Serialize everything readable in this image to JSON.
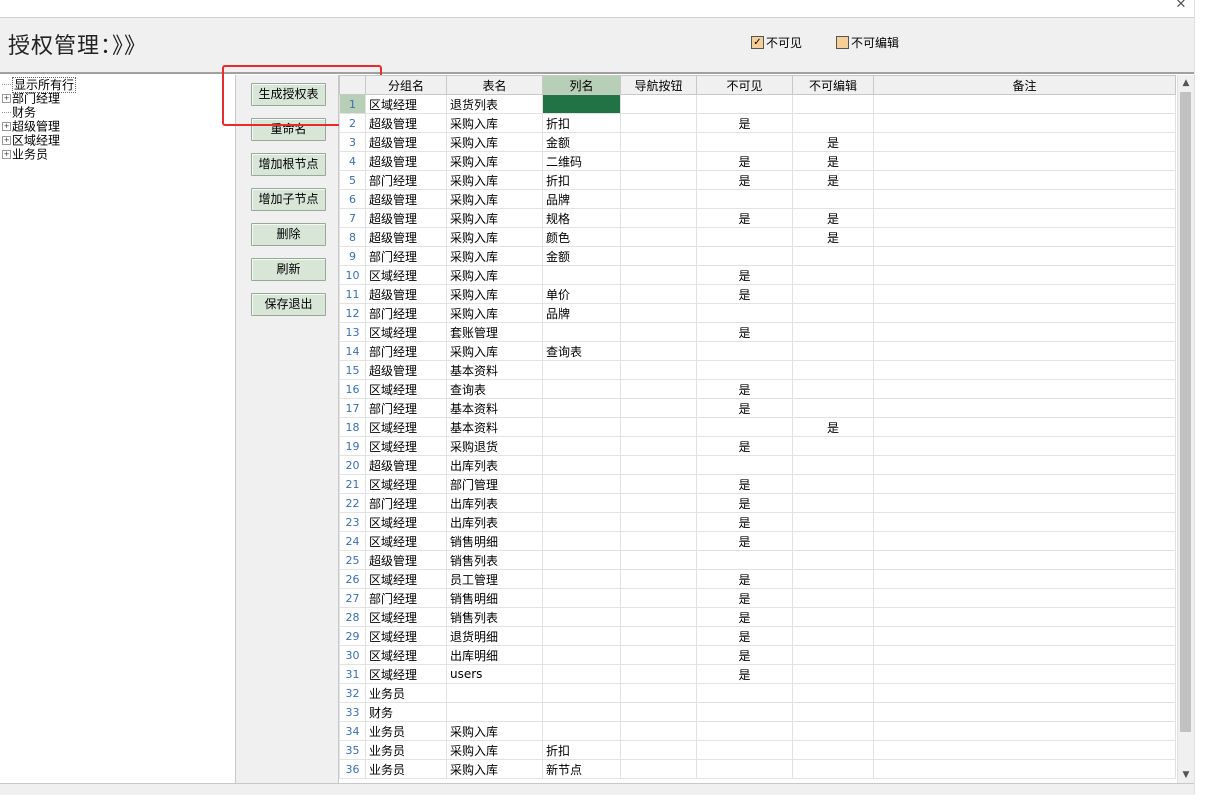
{
  "window": {
    "close_glyph": "✕"
  },
  "header": {
    "title": "授权管理：》》",
    "checkboxes": [
      {
        "label": "不可见",
        "checked": true
      },
      {
        "label": "不可编辑",
        "checked": false
      }
    ]
  },
  "tree": {
    "items": [
      {
        "label": "显示所有行",
        "expander": "",
        "selected": true
      },
      {
        "label": "部门经理",
        "expander": "+",
        "selected": false
      },
      {
        "label": "财务",
        "expander": "",
        "selected": false
      },
      {
        "label": "超级管理",
        "expander": "+",
        "selected": false
      },
      {
        "label": "区域经理",
        "expander": "+",
        "selected": false
      },
      {
        "label": "业务员",
        "expander": "+",
        "selected": false
      }
    ]
  },
  "buttons": {
    "generate": "生成授权表",
    "rename": "重命名",
    "add_root": "增加根节点",
    "add_child": "增加子节点",
    "delete": "删除",
    "refresh": "刷新",
    "save_exit": "保存退出"
  },
  "grid": {
    "columns": [
      "",
      "分组名",
      "表名",
      "列名",
      "导航按钮",
      "不可见",
      "不可编辑",
      "备注"
    ],
    "active_column": "列名",
    "current_row": 1,
    "rows": [
      {
        "n": "1",
        "group": "区域经理",
        "table": "退货列表",
        "col": "",
        "nav": "",
        "invisible": "",
        "noedit": "",
        "note": ""
      },
      {
        "n": "2",
        "group": "超级管理",
        "table": "采购入库",
        "col": "折扣",
        "nav": "",
        "invisible": "是",
        "noedit": "",
        "note": ""
      },
      {
        "n": "3",
        "group": "超级管理",
        "table": "采购入库",
        "col": "金额",
        "nav": "",
        "invisible": "",
        "noedit": "是",
        "note": ""
      },
      {
        "n": "4",
        "group": "超级管理",
        "table": "采购入库",
        "col": "二维码",
        "nav": "",
        "invisible": "是",
        "noedit": "是",
        "note": ""
      },
      {
        "n": "5",
        "group": "部门经理",
        "table": "采购入库",
        "col": "折扣",
        "nav": "",
        "invisible": "是",
        "noedit": "是",
        "note": ""
      },
      {
        "n": "6",
        "group": "超级管理",
        "table": "采购入库",
        "col": "品牌",
        "nav": "",
        "invisible": "",
        "noedit": "",
        "note": ""
      },
      {
        "n": "7",
        "group": "超级管理",
        "table": "采购入库",
        "col": "规格",
        "nav": "",
        "invisible": "是",
        "noedit": "是",
        "note": ""
      },
      {
        "n": "8",
        "group": "超级管理",
        "table": "采购入库",
        "col": "颜色",
        "nav": "",
        "invisible": "",
        "noedit": "是",
        "note": ""
      },
      {
        "n": "9",
        "group": "部门经理",
        "table": "采购入库",
        "col": "金额",
        "nav": "",
        "invisible": "",
        "noedit": "",
        "note": ""
      },
      {
        "n": "10",
        "group": "区域经理",
        "table": "采购入库",
        "col": "",
        "nav": "",
        "invisible": "是",
        "noedit": "",
        "note": ""
      },
      {
        "n": "11",
        "group": "超级管理",
        "table": "采购入库",
        "col": "单价",
        "nav": "",
        "invisible": "是",
        "noedit": "",
        "note": ""
      },
      {
        "n": "12",
        "group": "部门经理",
        "table": "采购入库",
        "col": "品牌",
        "nav": "",
        "invisible": "",
        "noedit": "",
        "note": ""
      },
      {
        "n": "13",
        "group": "区域经理",
        "table": "套账管理",
        "col": "",
        "nav": "",
        "invisible": "是",
        "noedit": "",
        "note": ""
      },
      {
        "n": "14",
        "group": "部门经理",
        "table": "采购入库",
        "col": "查询表",
        "nav": "",
        "invisible": "",
        "noedit": "",
        "note": ""
      },
      {
        "n": "15",
        "group": "超级管理",
        "table": "基本资料",
        "col": "",
        "nav": "",
        "invisible": "",
        "noedit": "",
        "note": ""
      },
      {
        "n": "16",
        "group": "区域经理",
        "table": "查询表",
        "col": "",
        "nav": "",
        "invisible": "是",
        "noedit": "",
        "note": ""
      },
      {
        "n": "17",
        "group": "部门经理",
        "table": "基本资料",
        "col": "",
        "nav": "",
        "invisible": "是",
        "noedit": "",
        "note": ""
      },
      {
        "n": "18",
        "group": "区域经理",
        "table": "基本资料",
        "col": "",
        "nav": "",
        "invisible": "",
        "noedit": "是",
        "note": ""
      },
      {
        "n": "19",
        "group": "区域经理",
        "table": "采购退货",
        "col": "",
        "nav": "",
        "invisible": "是",
        "noedit": "",
        "note": ""
      },
      {
        "n": "20",
        "group": "超级管理",
        "table": "出库列表",
        "col": "",
        "nav": "",
        "invisible": "",
        "noedit": "",
        "note": ""
      },
      {
        "n": "21",
        "group": "区域经理",
        "table": "部门管理",
        "col": "",
        "nav": "",
        "invisible": "是",
        "noedit": "",
        "note": ""
      },
      {
        "n": "22",
        "group": "部门经理",
        "table": "出库列表",
        "col": "",
        "nav": "",
        "invisible": "是",
        "noedit": "",
        "note": ""
      },
      {
        "n": "23",
        "group": "区域经理",
        "table": "出库列表",
        "col": "",
        "nav": "",
        "invisible": "是",
        "noedit": "",
        "note": ""
      },
      {
        "n": "24",
        "group": "区域经理",
        "table": "销售明细",
        "col": "",
        "nav": "",
        "invisible": "是",
        "noedit": "",
        "note": ""
      },
      {
        "n": "25",
        "group": "超级管理",
        "table": "销售列表",
        "col": "",
        "nav": "",
        "invisible": "",
        "noedit": "",
        "note": ""
      },
      {
        "n": "26",
        "group": "区域经理",
        "table": "员工管理",
        "col": "",
        "nav": "",
        "invisible": "是",
        "noedit": "",
        "note": ""
      },
      {
        "n": "27",
        "group": "部门经理",
        "table": "销售明细",
        "col": "",
        "nav": "",
        "invisible": "是",
        "noedit": "",
        "note": ""
      },
      {
        "n": "28",
        "group": "区域经理",
        "table": "销售列表",
        "col": "",
        "nav": "",
        "invisible": "是",
        "noedit": "",
        "note": ""
      },
      {
        "n": "29",
        "group": "区域经理",
        "table": "退货明细",
        "col": "",
        "nav": "",
        "invisible": "是",
        "noedit": "",
        "note": ""
      },
      {
        "n": "30",
        "group": "区域经理",
        "table": "出库明细",
        "col": "",
        "nav": "",
        "invisible": "是",
        "noedit": "",
        "note": ""
      },
      {
        "n": "31",
        "group": "区域经理",
        "table": "users",
        "col": "",
        "nav": "",
        "invisible": "是",
        "noedit": "",
        "note": ""
      },
      {
        "n": "32",
        "group": "业务员",
        "table": "",
        "col": "",
        "nav": "",
        "invisible": "",
        "noedit": "",
        "note": ""
      },
      {
        "n": "33",
        "group": "财务",
        "table": "",
        "col": "",
        "nav": "",
        "invisible": "",
        "noedit": "",
        "note": ""
      },
      {
        "n": "34",
        "group": "业务员",
        "table": "采购入库",
        "col": "",
        "nav": "",
        "invisible": "",
        "noedit": "",
        "note": ""
      },
      {
        "n": "35",
        "group": "业务员",
        "table": "采购入库",
        "col": "折扣",
        "nav": "",
        "invisible": "",
        "noedit": "",
        "note": ""
      },
      {
        "n": "36",
        "group": "业务员",
        "table": "采购入库",
        "col": "新节点",
        "nav": "",
        "invisible": "",
        "noedit": "",
        "note": ""
      }
    ]
  },
  "scrollbar": {
    "up_glyph": "▲",
    "down_glyph": "▼"
  },
  "colors": {
    "selected_cell": "#217346",
    "active_header": "#b6cfb6",
    "button_bg": "#d8e6d8",
    "highlight_box": "#e82c2c",
    "checkbox_fill": "#f6cf98"
  }
}
